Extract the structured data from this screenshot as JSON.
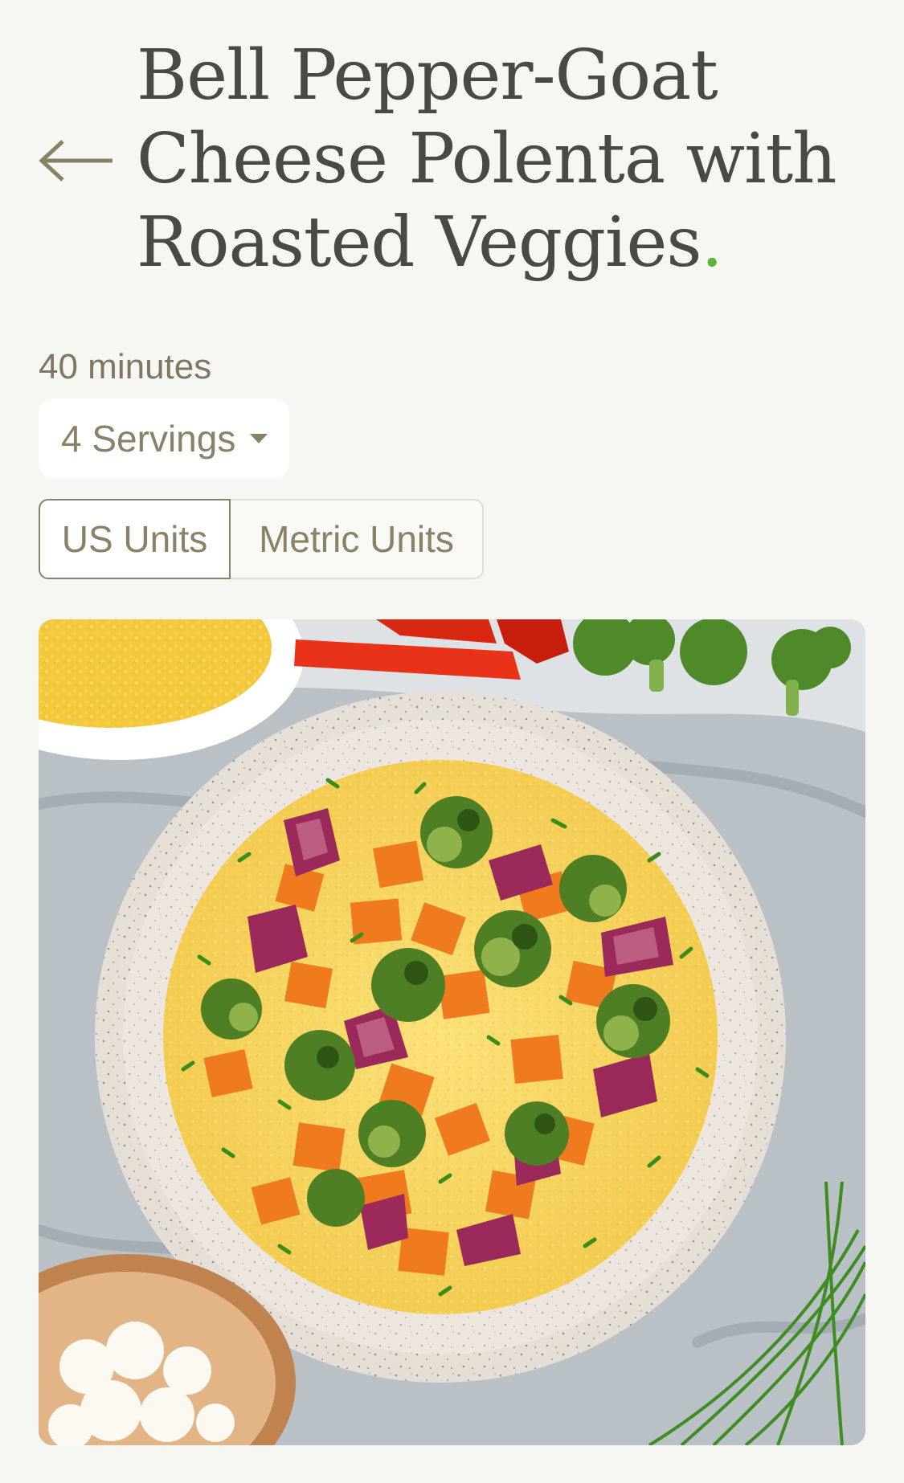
{
  "recipe": {
    "title": "Bell Pepper-Goat Cheese Polenta with Roasted Veggies",
    "title_dot": ".",
    "time": "40 minutes",
    "servings": {
      "selected": "4 Servings"
    },
    "units": {
      "us_label": "US Units",
      "metric_label": "Metric Units",
      "selected": "US Units"
    },
    "image": {
      "alt": "Bell Pepper-Goat Cheese Polenta with Roasted Veggies"
    }
  },
  "icons": {
    "back": "left-arrow-icon",
    "dropdown": "caret-down-icon"
  },
  "colors": {
    "background": "#f6f6f2",
    "title": "#4a4a45",
    "accent_dot": "#5fb33b",
    "muted_text": "#8a8169"
  }
}
